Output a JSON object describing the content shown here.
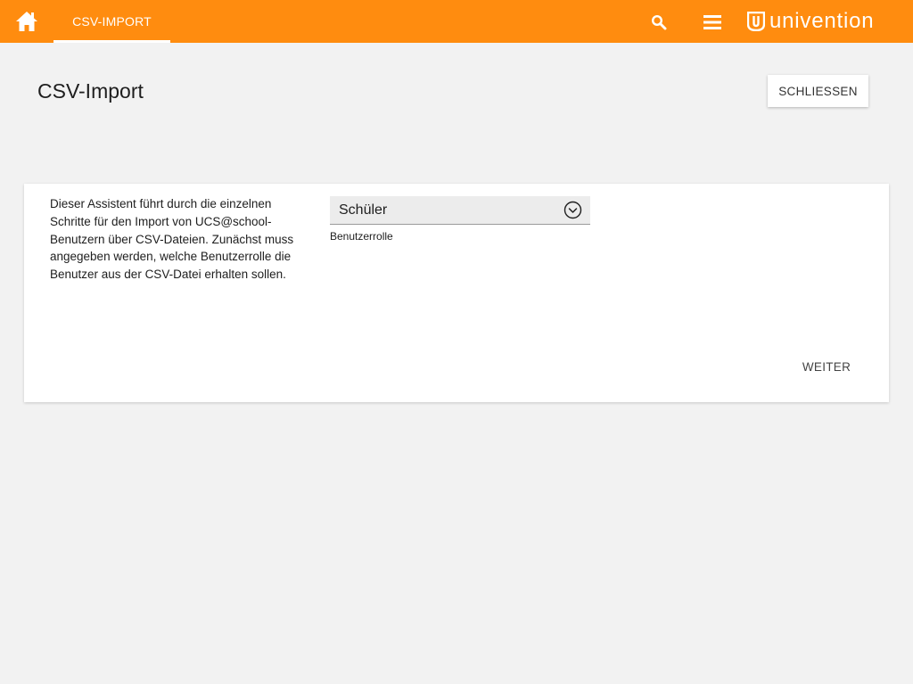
{
  "colors": {
    "topbar": "#ff8c0f",
    "background": "#f2f2f2",
    "card": "#ffffff"
  },
  "header": {
    "home_icon": "home-icon",
    "active_tab": "CSV-IMPORT",
    "search_icon": "search-icon",
    "menu_icon": "hamburger-menu-icon",
    "brand": "univention"
  },
  "page": {
    "title": "CSV-Import",
    "close_label": "SCHLIESSEN"
  },
  "wizard": {
    "description": "Dieser Assistent führt durch die einzelnen Schritte für den Import von UCS@school-Benutzern über CSV-Dateien. Zunächst muss angegeben werden, welche Benutzerrolle die Benutzer aus der CSV-Datei erhalten sollen.",
    "role_select": {
      "value": "Schüler",
      "label": "Benutzerrolle"
    },
    "next_label": "WEITER"
  }
}
